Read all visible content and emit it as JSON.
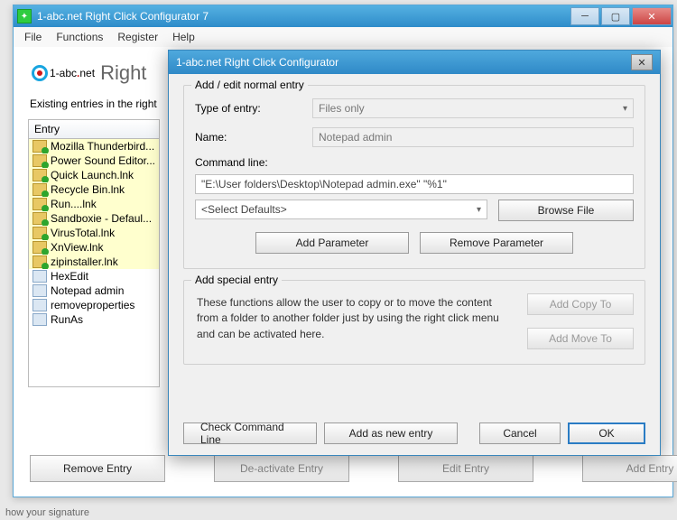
{
  "main": {
    "title": "1-abc.net Right Click Configurator 7",
    "menu": [
      "File",
      "Functions",
      "Register",
      "Help"
    ],
    "logo_prefix": "1-abc",
    "logo_dot": ".",
    "logo_suffix": "net",
    "heading": "Right",
    "existing_label": "Existing entries in the right",
    "grid_header": "Entry",
    "entries": [
      {
        "label": "Mozilla Thunderbird...",
        "folder": true
      },
      {
        "label": "Power Sound Editor...",
        "folder": true
      },
      {
        "label": "Quick Launch.lnk",
        "folder": true
      },
      {
        "label": "Recycle Bin.lnk",
        "folder": true
      },
      {
        "label": "Run....lnk",
        "folder": true
      },
      {
        "label": "Sandboxie - Defaul...",
        "folder": true
      },
      {
        "label": "VirusTotal.lnk",
        "folder": true
      },
      {
        "label": "XnView.lnk",
        "folder": true
      },
      {
        "label": "zipinstaller.lnk",
        "folder": true
      },
      {
        "label": "HexEdit",
        "folder": false
      },
      {
        "label": "Notepad admin",
        "folder": false
      },
      {
        "label": "removeproperties",
        "folder": false
      },
      {
        "label": "RunAs",
        "folder": false
      }
    ],
    "buttons": {
      "remove": "Remove Entry",
      "deactivate": "De-activate Entry",
      "edit": "Edit Entry",
      "add": "Add Entry"
    }
  },
  "dialog": {
    "title": "1-abc.net Right Click Configurator",
    "group_normal": "Add / edit normal entry",
    "labels": {
      "type": "Type of entry:",
      "name": "Name:",
      "cmd": "Command line:"
    },
    "values": {
      "type": "Files only",
      "name": "Notepad admin",
      "cmd": "\"E:\\User folders\\Desktop\\Notepad admin.exe\" \"%1\"",
      "defaults": "<Select Defaults>"
    },
    "buttons": {
      "browse": "Browse File",
      "add_param": "Add Parameter",
      "remove_param": "Remove Parameter"
    },
    "group_special": "Add special entry",
    "special_text": "These functions allow the user to copy or to move the content from a folder to another folder just by using the right click menu and can be activated here.",
    "special_buttons": {
      "copy": "Add Copy To",
      "move": "Add Move To"
    },
    "footer": {
      "check": "Check Command Line",
      "addnew": "Add as new entry",
      "cancel": "Cancel",
      "ok": "OK"
    }
  },
  "status": "how your signature"
}
